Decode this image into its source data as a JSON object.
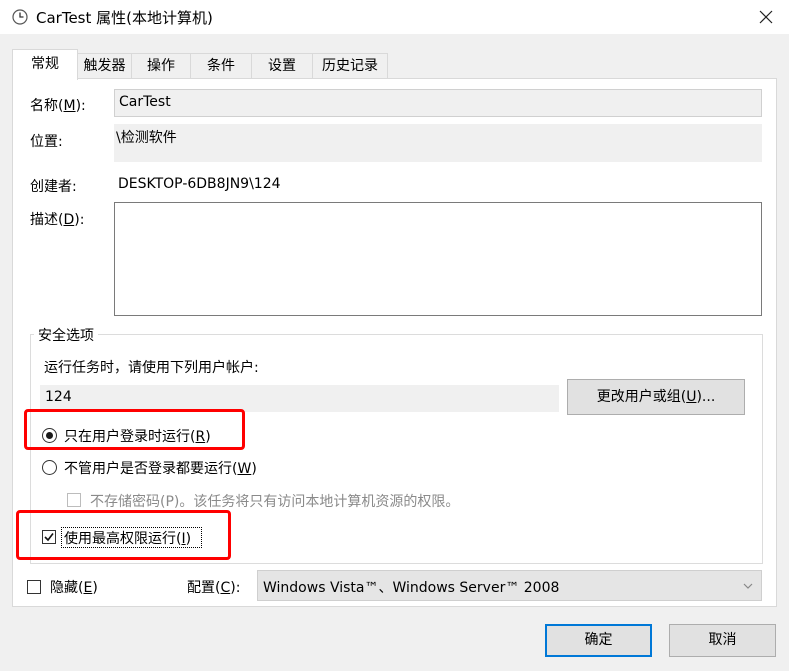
{
  "window": {
    "title": "CarTest 属性(本地计算机)",
    "close_icon": "×"
  },
  "tabs": [
    {
      "label": "常规",
      "active": true
    },
    {
      "label": "触发器"
    },
    {
      "label": "操作"
    },
    {
      "label": "条件"
    },
    {
      "label": "设置"
    },
    {
      "label": "历史记录"
    }
  ],
  "general": {
    "name_label": "名称(M):",
    "name_value": "CarTest",
    "location_label": "位置:",
    "location_value": "\\检测软件",
    "author_label": "创建者:",
    "author_value": "DESKTOP-6DB8JN9\\124",
    "description_label": "描述(D):",
    "description_value": ""
  },
  "security": {
    "group_title": "安全选项",
    "run_as_prompt": "运行任务时，请使用下列用户帐户:",
    "user_account": "124",
    "change_user_button": "更改用户或组(U)...",
    "option_logged_on": "只在用户登录时运行(R)",
    "option_whether_logged": "不管用户是否登录都要运行(W)",
    "no_store_password": "不存储密码(P)。该任务将只有访问本地计算机资源的权限。",
    "highest_privileges": "使用最高权限运行(I)",
    "selected_option": "option_logged_on",
    "highest_privileges_checked": true,
    "no_store_password_checked": false
  },
  "bottom": {
    "hidden_label": "隐藏(E)",
    "hidden_checked": false,
    "configure_label": "配置(C):",
    "configure_value": "Windows Vista™、Windows Server™ 2008"
  },
  "buttons": {
    "ok": "确定",
    "cancel": "取消"
  },
  "colors": {
    "highlight": "#ff0000",
    "default_button_border": "#0078d7"
  }
}
